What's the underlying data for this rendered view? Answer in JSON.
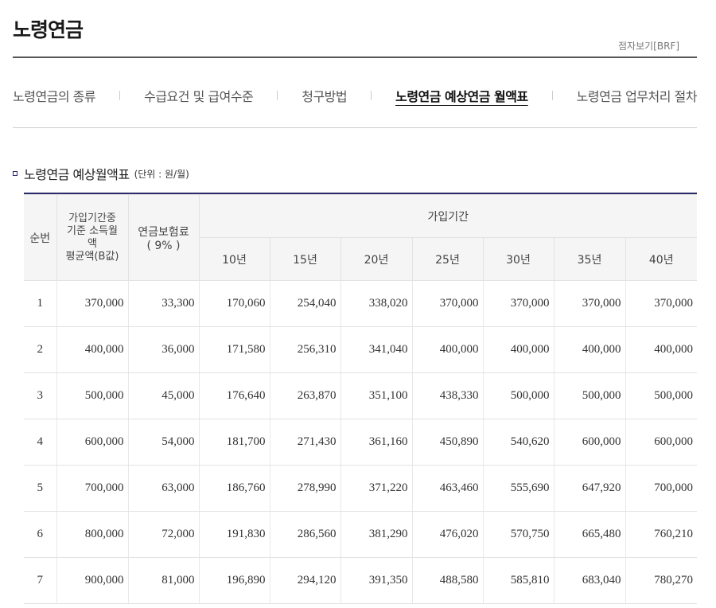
{
  "page": {
    "title": "노령연금",
    "brf_link": "점자보기[BRF]"
  },
  "tabs": [
    {
      "label": "노령연금의 종류",
      "active": false
    },
    {
      "label": "수급요건 및 급여수준",
      "active": false
    },
    {
      "label": "청구방법",
      "active": false
    },
    {
      "label": "노령연금 예상연금 월액표",
      "active": true
    },
    {
      "label": "노령연금 업무처리 절차",
      "active": false
    }
  ],
  "section": {
    "title": "노령연금 예상월액표",
    "unit": "(단위 : 원/월)"
  },
  "table": {
    "headers": {
      "no": "순번",
      "base_line1": "가입기간중",
      "base_line2": "기준 소득월",
      "base_line3": "액",
      "base_line4": "평균액(B값)",
      "premium_line1": "연금보험료",
      "premium_line2": "( 9% )",
      "period": "가입기간",
      "years": [
        "10년",
        "15년",
        "20년",
        "25년",
        "30년",
        "35년",
        "40년"
      ]
    },
    "rows": [
      [
        "1",
        "370,000",
        "33,300",
        "170,060",
        "254,040",
        "338,020",
        "370,000",
        "370,000",
        "370,000",
        "370,000"
      ],
      [
        "2",
        "400,000",
        "36,000",
        "171,580",
        "256,310",
        "341,040",
        "400,000",
        "400,000",
        "400,000",
        "400,000"
      ],
      [
        "3",
        "500,000",
        "45,000",
        "176,640",
        "263,870",
        "351,100",
        "438,330",
        "500,000",
        "500,000",
        "500,000"
      ],
      [
        "4",
        "600,000",
        "54,000",
        "181,700",
        "271,430",
        "361,160",
        "450,890",
        "540,620",
        "600,000",
        "600,000"
      ],
      [
        "5",
        "700,000",
        "63,000",
        "186,760",
        "278,990",
        "371,220",
        "463,460",
        "555,690",
        "647,920",
        "700,000"
      ],
      [
        "6",
        "800,000",
        "72,000",
        "191,830",
        "286,560",
        "381,290",
        "476,020",
        "570,750",
        "665,480",
        "760,210"
      ],
      [
        "7",
        "900,000",
        "81,000",
        "196,890",
        "294,120",
        "391,350",
        "488,580",
        "585,810",
        "683,040",
        "780,270"
      ]
    ]
  }
}
